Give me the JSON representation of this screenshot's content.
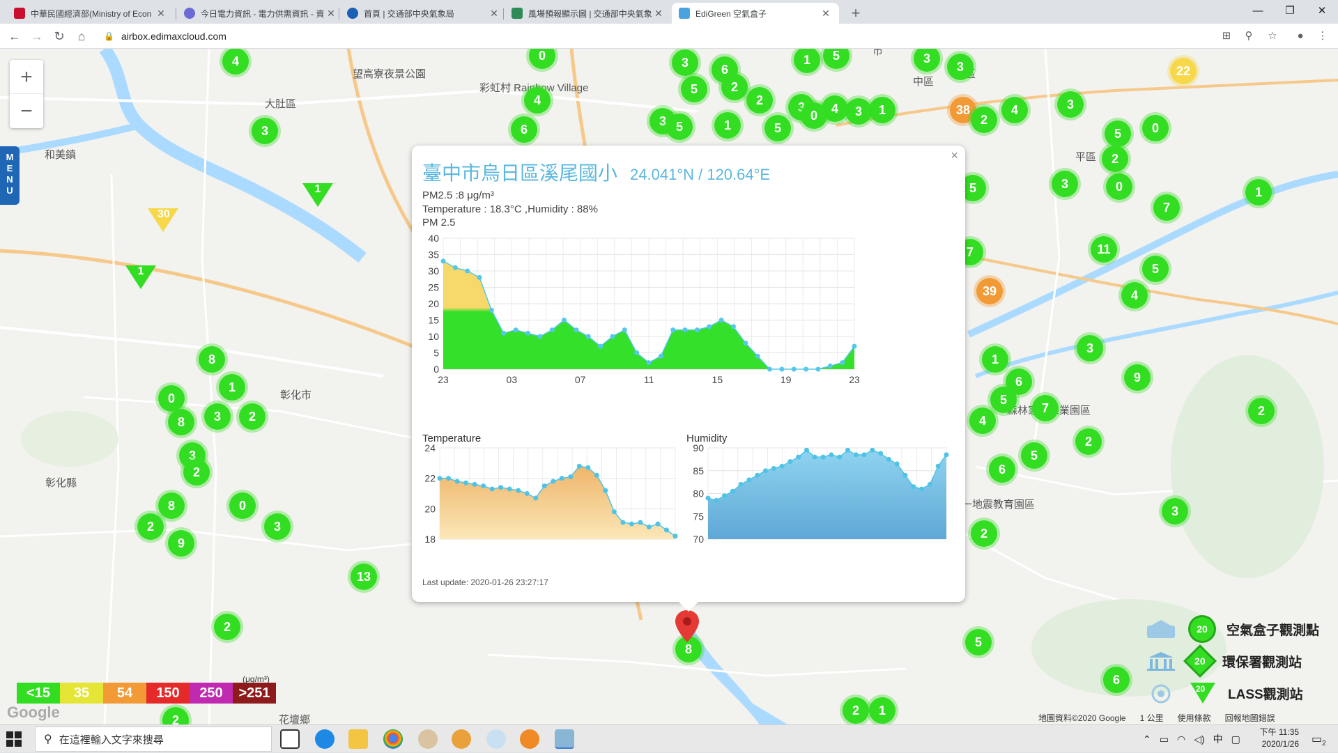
{
  "browser": {
    "tabs": [
      {
        "title": "中華民國經濟部(Ministry of Econ",
        "favicon": "#c8102e",
        "active": false
      },
      {
        "title": "今日電力資訊 - 電力供需資訊 - 資",
        "favicon": "#6b6bd6",
        "active": false
      },
      {
        "title": "首頁 | 交通部中央氣象局",
        "favicon": "#1a5fb4",
        "active": false
      },
      {
        "title": "風場預報顯示圖 | 交通部中央氣象",
        "favicon": "#2e8b57",
        "active": false
      },
      {
        "title": "EdiGreen 空氣盒子",
        "favicon": "#4aa3df",
        "active": true
      }
    ],
    "new_tab": "+",
    "window": {
      "minimize": "—",
      "maximize": "❐",
      "close": "✕"
    },
    "url": "airbox.edimaxcloud.com",
    "nav": {
      "back": "←",
      "forward": "→",
      "reload": "↻",
      "home": "⌂"
    }
  },
  "map": {
    "zoom_in": "+",
    "zoom_out": "−",
    "menu_label": "MENU",
    "places": [
      {
        "name": "大肚區",
        "x": 380,
        "y": 68
      },
      {
        "name": "和美鎮",
        "x": 64,
        "y": 141
      },
      {
        "name": "彰化市",
        "x": 402,
        "y": 486
      },
      {
        "name": "望高寮夜景公園",
        "x": 506,
        "y": 25
      },
      {
        "name": "彩虹村 Rainbow Village",
        "x": 688,
        "y": 45
      },
      {
        "name": "中區",
        "x": 1310,
        "y": 36
      },
      {
        "name": "東區",
        "x": 1370,
        "y": 25
      },
      {
        "name": "平區",
        "x": 1543,
        "y": 144
      },
      {
        "name": "九二一地震教育園區",
        "x": 1350,
        "y": 643
      },
      {
        "name": "森林家宮保業園區",
        "x": 1445,
        "y": 508
      },
      {
        "name": "花壇鄉",
        "x": 400,
        "y": 952
      },
      {
        "name": "彰化縣",
        "x": 65,
        "y": 612
      },
      {
        "name": "市",
        "x": 1252,
        "y": -8
      }
    ],
    "markers": [
      {
        "v": "4",
        "x": 338,
        "y": 18,
        "c": "green"
      },
      {
        "v": "3",
        "x": 380,
        "y": 118,
        "c": "green"
      },
      {
        "v": "0",
        "x": 778,
        "y": 10,
        "c": "green"
      },
      {
        "v": "4",
        "x": 771,
        "y": 74,
        "c": "green"
      },
      {
        "v": "6",
        "x": 752,
        "y": 116,
        "c": "green"
      },
      {
        "v": "3",
        "x": 983,
        "y": 20,
        "c": "green"
      },
      {
        "v": "5",
        "x": 996,
        "y": 58,
        "c": "green"
      },
      {
        "v": "6",
        "x": 1040,
        "y": 30,
        "c": "green"
      },
      {
        "v": "2",
        "x": 1054,
        "y": 55,
        "c": "green"
      },
      {
        "v": "3",
        "x": 951,
        "y": 104,
        "c": "green"
      },
      {
        "v": "5",
        "x": 975,
        "y": 112,
        "c": "green"
      },
      {
        "v": "1",
        "x": 1044,
        "y": 110,
        "c": "green"
      },
      {
        "v": "2",
        "x": 1090,
        "y": 74,
        "c": "green"
      },
      {
        "v": "5",
        "x": 1116,
        "y": 114,
        "c": "green"
      },
      {
        "v": "3",
        "x": 1150,
        "y": 84,
        "c": "green"
      },
      {
        "v": "0",
        "x": 1168,
        "y": 96,
        "c": "green"
      },
      {
        "v": "4",
        "x": 1198,
        "y": 86,
        "c": "green"
      },
      {
        "v": "3",
        "x": 1232,
        "y": 90,
        "c": "green"
      },
      {
        "v": "1",
        "x": 1266,
        "y": 88,
        "c": "green"
      },
      {
        "v": "1",
        "x": 1158,
        "y": 16,
        "c": "green"
      },
      {
        "v": "5",
        "x": 1200,
        "y": 10,
        "c": "green"
      },
      {
        "v": "3",
        "x": 1330,
        "y": 14,
        "c": "green"
      },
      {
        "v": "3",
        "x": 1378,
        "y": 26,
        "c": "green"
      },
      {
        "v": "38",
        "x": 1382,
        "y": 88,
        "c": "orange"
      },
      {
        "v": "2",
        "x": 1412,
        "y": 102,
        "c": "green"
      },
      {
        "v": "4",
        "x": 1456,
        "y": 88,
        "c": "green"
      },
      {
        "v": "3",
        "x": 1536,
        "y": 80,
        "c": "green"
      },
      {
        "v": "22",
        "x": 1698,
        "y": 32,
        "c": "yellow"
      },
      {
        "v": "5",
        "x": 1604,
        "y": 122,
        "c": "green"
      },
      {
        "v": "0",
        "x": 1658,
        "y": 114,
        "c": "green"
      },
      {
        "v": "2",
        "x": 1600,
        "y": 158,
        "c": "green"
      },
      {
        "v": "3",
        "x": 1528,
        "y": 194,
        "c": "green"
      },
      {
        "v": "0",
        "x": 1606,
        "y": 198,
        "c": "green"
      },
      {
        "v": "1",
        "x": 1806,
        "y": 206,
        "c": "green"
      },
      {
        "v": "7",
        "x": 1674,
        "y": 228,
        "c": "green"
      },
      {
        "v": "11",
        "x": 1584,
        "y": 288,
        "c": "green"
      },
      {
        "v": "5",
        "x": 1658,
        "y": 316,
        "c": "green"
      },
      {
        "v": "4",
        "x": 1628,
        "y": 354,
        "c": "green"
      },
      {
        "v": "39",
        "x": 1420,
        "y": 348,
        "c": "orange"
      },
      {
        "v": "3",
        "x": 1564,
        "y": 430,
        "c": "green"
      },
      {
        "v": "1",
        "x": 1428,
        "y": 446,
        "c": "green"
      },
      {
        "v": "6",
        "x": 1462,
        "y": 478,
        "c": "green"
      },
      {
        "v": "5",
        "x": 1440,
        "y": 504,
        "c": "green"
      },
      {
        "v": "7",
        "x": 1500,
        "y": 516,
        "c": "green"
      },
      {
        "v": "9",
        "x": 1632,
        "y": 472,
        "c": "green"
      },
      {
        "v": "4",
        "x": 1410,
        "y": 534,
        "c": "green"
      },
      {
        "v": "2",
        "x": 1562,
        "y": 564,
        "c": "green"
      },
      {
        "v": "5",
        "x": 1484,
        "y": 584,
        "c": "green"
      },
      {
        "v": "6",
        "x": 1438,
        "y": 604,
        "c": "green"
      },
      {
        "v": "2",
        "x": 1810,
        "y": 520,
        "c": "green"
      },
      {
        "v": "3",
        "x": 1686,
        "y": 664,
        "c": "green"
      },
      {
        "v": "2",
        "x": 1412,
        "y": 696,
        "c": "green"
      },
      {
        "v": "5",
        "x": 1404,
        "y": 852,
        "c": "green"
      },
      {
        "v": "6",
        "x": 1602,
        "y": 906,
        "c": "green"
      },
      {
        "v": "5",
        "x": 1396,
        "y": 200,
        "c": "green"
      },
      {
        "v": "7",
        "x": 1392,
        "y": 292,
        "c": "green"
      },
      {
        "v": "8",
        "x": 304,
        "y": 446,
        "c": "green"
      },
      {
        "v": "1",
        "x": 333,
        "y": 486,
        "c": "green"
      },
      {
        "v": "0",
        "x": 246,
        "y": 502,
        "c": "green"
      },
      {
        "v": "3",
        "x": 312,
        "y": 528,
        "c": "green"
      },
      {
        "v": "2",
        "x": 362,
        "y": 528,
        "c": "green"
      },
      {
        "v": "8",
        "x": 260,
        "y": 536,
        "c": "green"
      },
      {
        "v": "3",
        "x": 276,
        "y": 584,
        "c": "green"
      },
      {
        "v": "2",
        "x": 282,
        "y": 608,
        "c": "green"
      },
      {
        "v": "8",
        "x": 246,
        "y": 656,
        "c": "green"
      },
      {
        "v": "0",
        "x": 348,
        "y": 656,
        "c": "green"
      },
      {
        "v": "2",
        "x": 216,
        "y": 686,
        "c": "green"
      },
      {
        "v": "9",
        "x": 260,
        "y": 710,
        "c": "green"
      },
      {
        "v": "3",
        "x": 398,
        "y": 686,
        "c": "green"
      },
      {
        "v": "13",
        "x": 522,
        "y": 758,
        "c": "green"
      },
      {
        "v": "2",
        "x": 326,
        "y": 830,
        "c": "green"
      },
      {
        "v": "2",
        "x": 252,
        "y": 964,
        "c": "green"
      },
      {
        "v": "8",
        "x": 988,
        "y": 862,
        "c": "green"
      },
      {
        "v": "2",
        "x": 1228,
        "y": 950,
        "c": "green"
      },
      {
        "v": "1",
        "x": 1266,
        "y": 950,
        "c": "green"
      }
    ],
    "triangles": [
      {
        "v": "1",
        "x": 456,
        "y": 210,
        "c": "green"
      },
      {
        "v": "30",
        "x": 234,
        "y": 246,
        "c": "yellow"
      },
      {
        "v": "1",
        "x": 202,
        "y": 328,
        "c": "green"
      }
    ],
    "aqi_legend": [
      {
        "label": "<15",
        "color": "#33dd22"
      },
      {
        "label": "35",
        "color": "#e5e535"
      },
      {
        "label": "54",
        "color": "#f29a35"
      },
      {
        "label": "150",
        "color": "#e52a2a"
      },
      {
        "label": "250",
        "color": "#c02ab0"
      },
      {
        "label": ">251",
        "color": "#8e1b1b"
      }
    ],
    "aqi_unit": "(μg/m³)",
    "google": "Google",
    "station_legend": {
      "airbox": "空氣盒子觀測點",
      "epa": "環保署觀測站",
      "lass": "LASS觀測站",
      "sample_value": "20"
    },
    "footer": [
      "地圖資料©2020 Google",
      "1 公里",
      "使用條款",
      "回報地圖錯誤"
    ]
  },
  "popup": {
    "close": "×",
    "title": "臺中市烏日區溪尾國小",
    "coords": "24.041°N / 120.64°E",
    "pm_line": "PM2.5 :8 μg/m³",
    "env_line": "Temperature : 18.3°C ,Humidity : 88%",
    "pm_label": "PM 2.5",
    "temp_label": "Temperature",
    "hum_label": "Humidity",
    "last_update": "Last update: 2020-01-26 23:27:17"
  },
  "chart_data": [
    {
      "type": "area",
      "title": "PM 2.5",
      "x_ticks": [
        "23",
        "03",
        "07",
        "11",
        "15",
        "19",
        "23"
      ],
      "ylim": [
        0,
        40
      ],
      "y_ticks": [
        0,
        5,
        10,
        15,
        20,
        25,
        30,
        35,
        40
      ],
      "values": [
        33,
        31,
        30,
        28,
        18,
        11,
        12,
        11,
        10,
        12,
        15,
        12,
        10,
        7,
        10,
        12,
        5,
        2,
        4,
        12,
        12,
        12,
        13,
        15,
        13,
        8,
        4,
        0,
        0,
        0,
        0,
        0,
        1,
        2,
        7
      ]
    },
    {
      "type": "area",
      "title": "Temperature",
      "ylim": [
        18,
        24
      ],
      "y_ticks": [
        18,
        20,
        22,
        24
      ],
      "values": [
        22,
        22,
        21.8,
        21.7,
        21.6,
        21.5,
        21.3,
        21.4,
        21.3,
        21.2,
        21.0,
        20.7,
        21.5,
        21.8,
        22.0,
        22.1,
        22.8,
        22.7,
        22.2,
        21.2,
        19.8,
        19.1,
        19.0,
        19.1,
        18.8,
        19.0,
        18.6,
        18.2
      ]
    },
    {
      "type": "area",
      "title": "Humidity",
      "ylim": [
        70,
        90
      ],
      "y_ticks": [
        70,
        75,
        80,
        85,
        90
      ],
      "values": [
        79,
        78.5,
        79.5,
        80.5,
        82,
        83,
        84,
        85,
        85.5,
        86,
        87,
        88,
        89.5,
        88,
        88,
        88.5,
        88,
        89.5,
        88.5,
        88.5,
        89.5,
        88.8,
        87.5,
        86.5,
        84,
        81.5,
        81,
        82,
        86,
        88.5
      ]
    }
  ],
  "taskbar": {
    "search_placeholder": "在這裡輸入文字來搜尋",
    "tray_ime": "中",
    "time": "下午 11:35",
    "date": "2020/1/26",
    "notifications": "2"
  }
}
